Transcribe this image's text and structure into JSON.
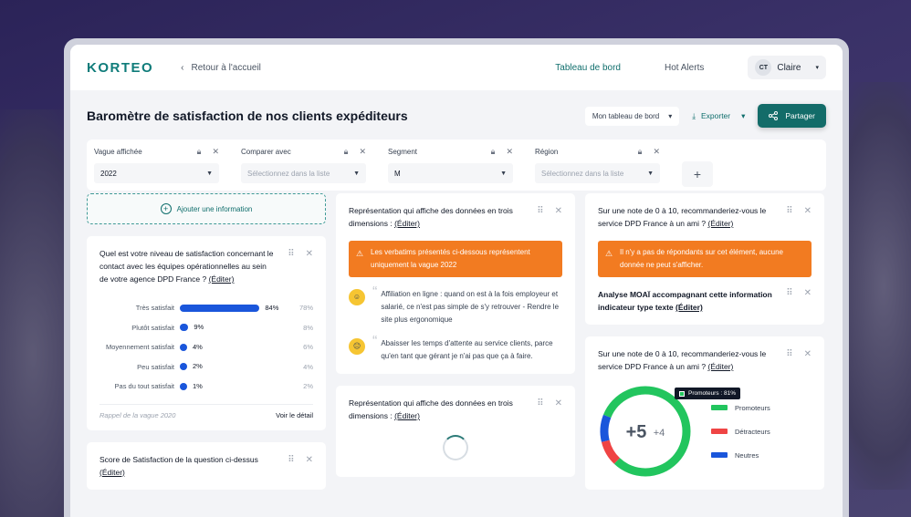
{
  "header": {
    "logo": "KORTEO",
    "back_label": "Retour à l'accueil",
    "nav": [
      {
        "label": "Tableau de bord",
        "active": true
      },
      {
        "label": "Hot Alerts",
        "active": false
      }
    ],
    "user": {
      "initials": "CT",
      "name": "Claire"
    }
  },
  "page": {
    "title": "Baromètre de satisfaction de nos clients expéditeurs",
    "dashboard_select": "Mon tableau de bord",
    "export_label": "Exporter",
    "share_label": "Partager"
  },
  "filters": [
    {
      "label": "Vague affichée",
      "value": "2022",
      "placeholder": false
    },
    {
      "label": "Comparer avec",
      "value": "Sélectionnez dans la liste",
      "placeholder": true
    },
    {
      "label": "Segment",
      "value": "M",
      "placeholder": false
    },
    {
      "label": "Région",
      "value": "Sélectionnez dans la liste",
      "placeholder": true
    }
  ],
  "add_info_label": "Ajouter une information",
  "satisfaction_card": {
    "question": "Quel est votre niveau de satisfaction concernant le contact avec les équipes opérationnelles au sein de votre agence DPD France ?",
    "edit": "(Éditer)",
    "footer_left": "Rappel de la vague 2020",
    "footer_right": "Voir le détail"
  },
  "chart_data": {
    "type": "bar",
    "categories": [
      "Très satisfait",
      "Plutôt satisfait",
      "Moyennement satisfait",
      "Peu satisfait",
      "Pas du tout satisfait"
    ],
    "values": [
      84,
      9,
      4,
      2,
      1
    ],
    "value_labels": [
      "84%",
      "9%",
      "4%",
      "2%",
      "1%"
    ],
    "compare_labels": [
      "78%",
      "8%",
      "6%",
      "4%",
      "2%"
    ],
    "bar_color": "#1a56db"
  },
  "score_card": {
    "question": "Score de Satisfaction de la question ci-dessus",
    "edit": "(Éditer)"
  },
  "verbatim_card": {
    "title": "Représentation qui affiche des données en trois dimensions :",
    "edit": "(Éditer)",
    "alert": "Les verbatims présentés ci-dessous représentent uniquement la vague 2022",
    "items": [
      {
        "emoji": "smile-emoji",
        "text": "Affiliation en ligne : quand on est à la fois employeur et salarié, ce n'est pas simple de s'y retrouver - Rendre le site plus ergonomique"
      },
      {
        "emoji": "meh-emoji",
        "text": "Abaisser les temps d'attente au service clients, parce qu'en tant que gérant je n'ai pas que ça à faire."
      }
    ]
  },
  "loading_card": {
    "title": "Représentation qui affiche des données en trois dimensions :",
    "edit": "(Éditer)"
  },
  "nps_card_1": {
    "question": "Sur une note de 0 à 10, recommanderiez-vous le service DPD France à un ami ?",
    "edit": "(Éditer)",
    "alert": "Il n'y a pas de répondants sur cet élément, aucune donnée ne peut s'afficher.",
    "analysis": "Analyse MOAÏ accompagnant cette information indicateur type texte",
    "analysis_edit": "(Éditer)"
  },
  "nps_card_2": {
    "question": "Sur une note de 0 à 10, recommanderiez-vous le service DPD France à un ami ?",
    "edit": "(Éditer)",
    "score": "+5",
    "compare": "+4",
    "tooltip": "Promoteurs : 81%",
    "segments": [
      {
        "name": "Promoteurs",
        "value": 81,
        "color": "#22c55e"
      },
      {
        "name": "Détracteurs",
        "value": 9,
        "color": "#ef4444"
      },
      {
        "name": "Neutres",
        "value": 10,
        "color": "#1a56db"
      }
    ]
  },
  "colors": {
    "brand": "#0f7c7a",
    "alert": "#f27b21"
  }
}
